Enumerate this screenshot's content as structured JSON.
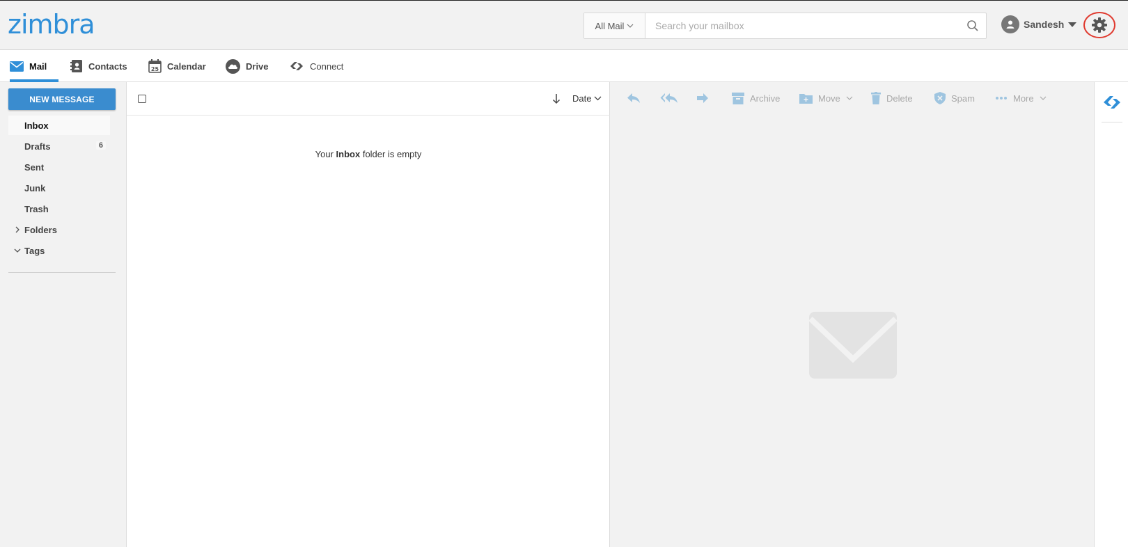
{
  "header": {
    "logo": "zimbra",
    "search_scope": "All Mail",
    "search_placeholder": "Search your mailbox",
    "user_name": "Sandesh"
  },
  "app_tabs": [
    {
      "label": "Mail",
      "icon": "mail-icon",
      "active": true
    },
    {
      "label": "Contacts",
      "icon": "contacts-icon"
    },
    {
      "label": "Calendar",
      "icon": "calendar-icon",
      "icon_text": "25"
    },
    {
      "label": "Drive",
      "icon": "cloud-icon"
    },
    {
      "label": "Connect",
      "icon": "connect-icon"
    }
  ],
  "sidebar": {
    "new_message_label": "NEW MESSAGE",
    "folders": [
      {
        "label": "Inbox",
        "active": true
      },
      {
        "label": "Drafts",
        "count": "6"
      },
      {
        "label": "Sent"
      },
      {
        "label": "Junk"
      },
      {
        "label": "Trash"
      },
      {
        "label": "Folders",
        "chevron": "right"
      },
      {
        "label": "Tags",
        "chevron": "down"
      }
    ]
  },
  "message_list": {
    "sort_label": "Date",
    "empty_prefix": "Your",
    "empty_folder": "Inbox",
    "empty_suffix": "folder is empty"
  },
  "reading_toolbar": {
    "archive": "Archive",
    "move": "Move",
    "delete": "Delete",
    "spam": "Spam",
    "more": "More"
  },
  "colors": {
    "accent": "#2f8fd8",
    "toolbar_icon": "#9fc5e0",
    "settings_highlight": "#e03a2f"
  }
}
